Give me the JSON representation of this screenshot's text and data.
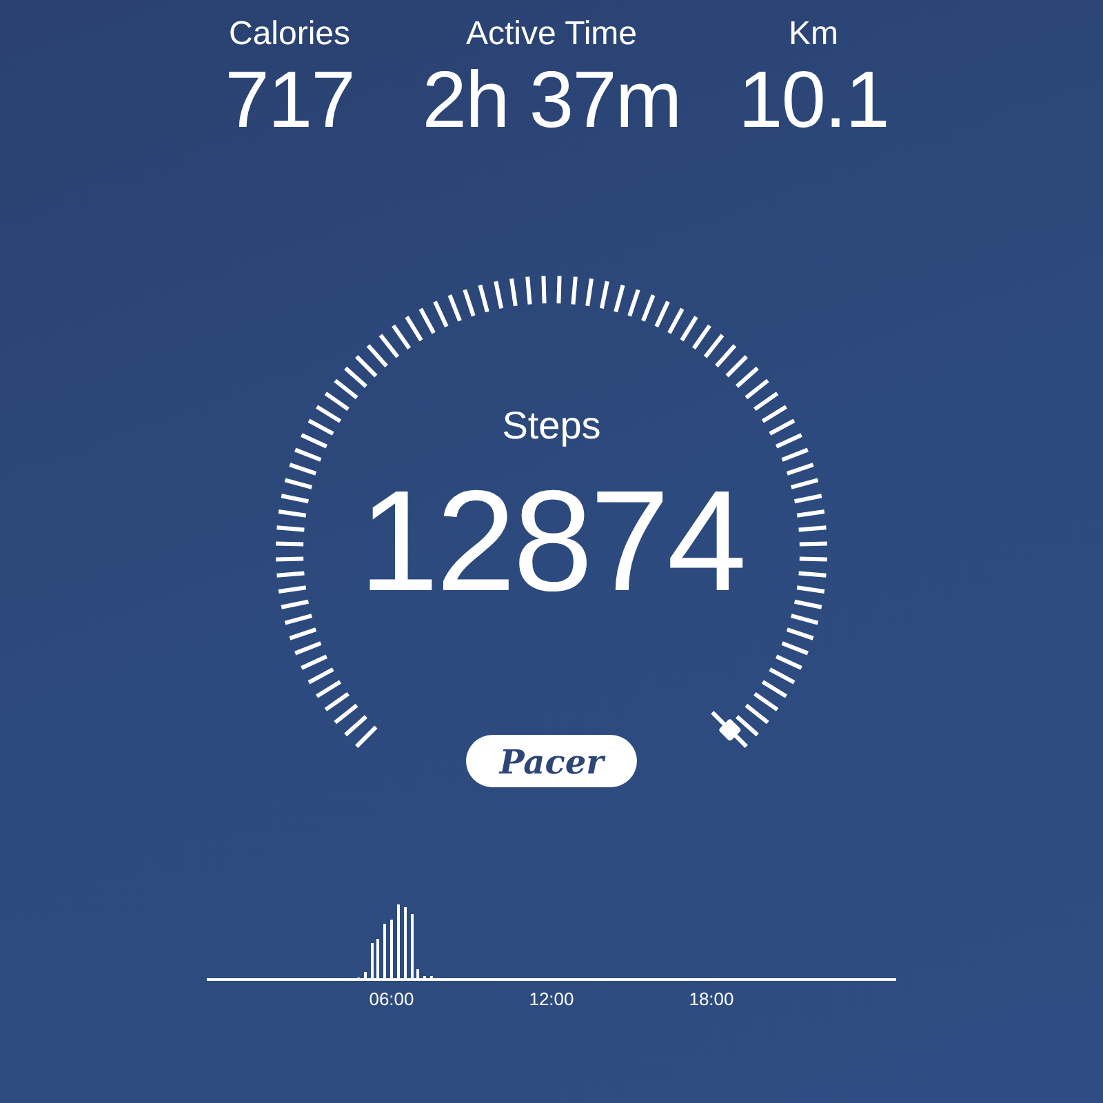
{
  "stats": [
    {
      "label": "Calories",
      "value": "717"
    },
    {
      "label": "Active Time",
      "value": "2h 37m"
    },
    {
      "label": "Km",
      "value": "10.1"
    }
  ],
  "gauge": {
    "label": "Steps",
    "value": "12874"
  },
  "logo": {
    "text": "Pacer"
  },
  "activity_chart": {
    "time_labels": [
      "06:00",
      "12:00",
      "18:00"
    ]
  }
}
